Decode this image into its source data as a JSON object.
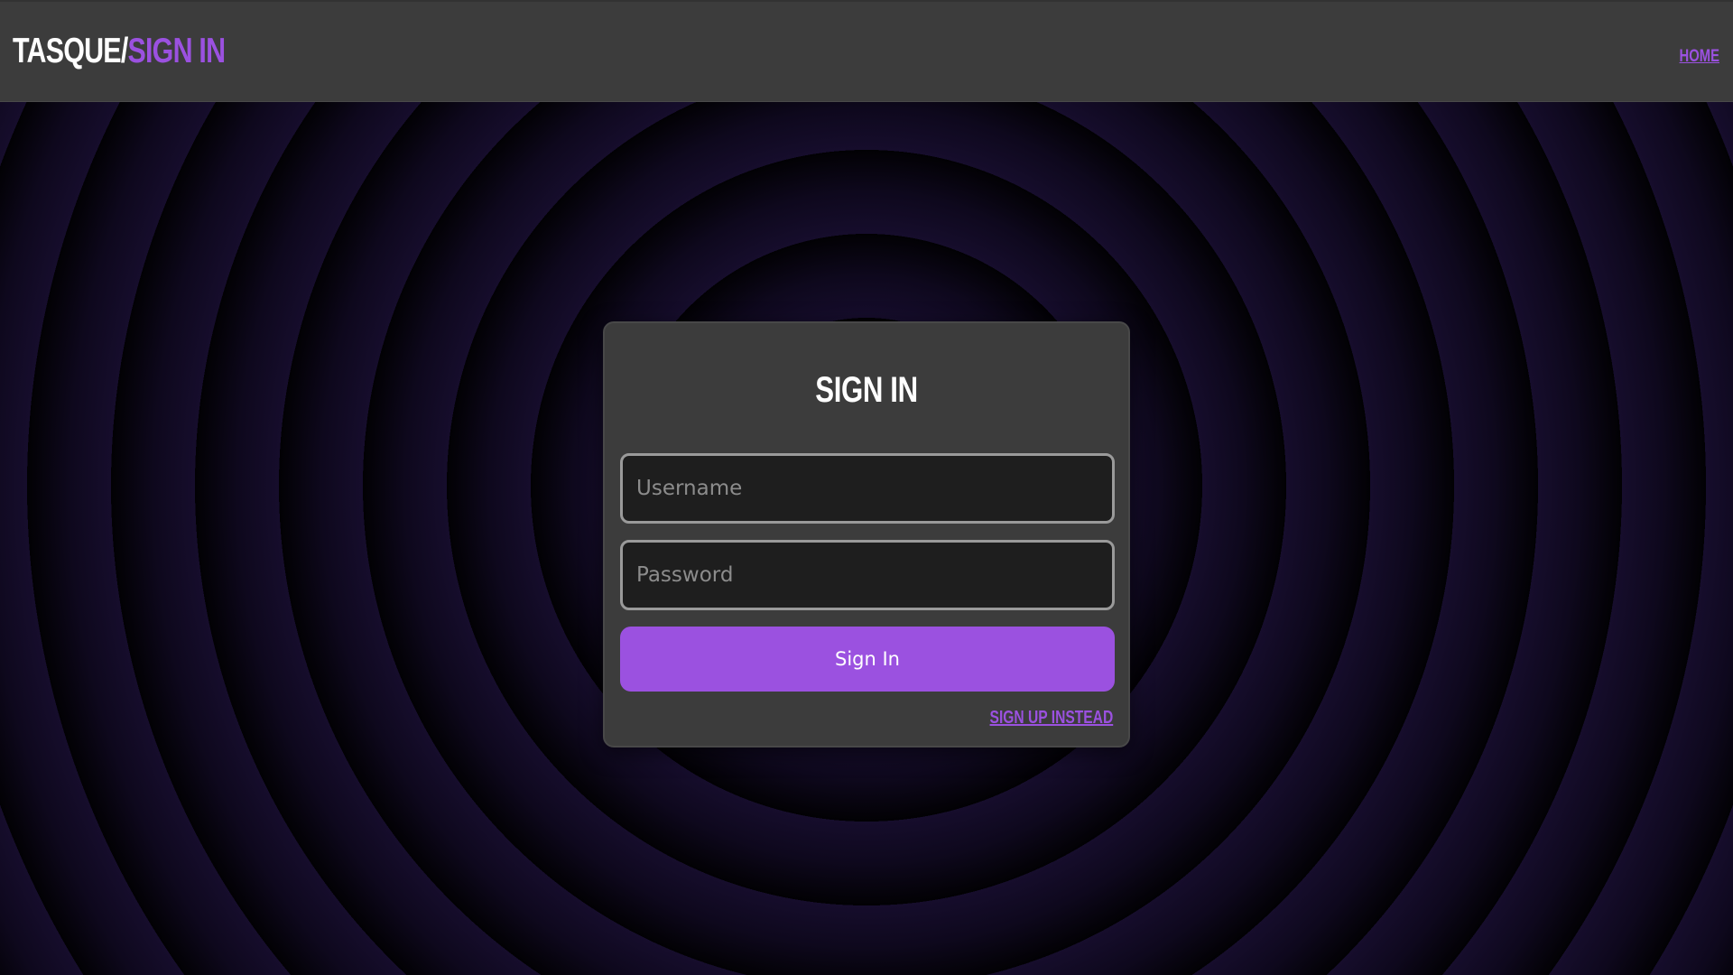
{
  "header": {
    "brand_app": "TASQUE/",
    "brand_page": "SIGN IN",
    "nav_home": "HOME"
  },
  "signin_form": {
    "title": "SIGN IN",
    "username_placeholder": "Username",
    "username_value": "",
    "password_placeholder": "Password",
    "password_value": "",
    "submit_label": "Sign In",
    "signup_link": "SIGN UP INSTEAD"
  },
  "colors": {
    "accent": "#9b51e0",
    "header_bg": "#3c3c3c",
    "card_bg": "#3c3c3c",
    "input_bg": "#1e1e1e",
    "backdrop_ring_light": "#160d2c",
    "backdrop_ring_dark": "#020104"
  }
}
